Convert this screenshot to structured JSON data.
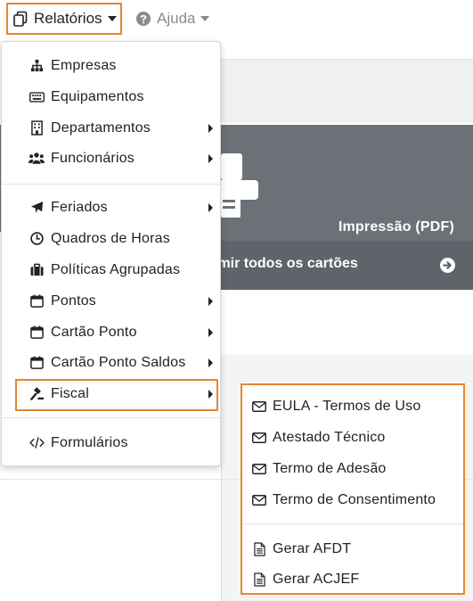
{
  "nav": {
    "relatorios_label": "Relatórios",
    "ajuda_label": "Ajuda",
    "relatorios_icon": "clipboard-copy-icon",
    "ajuda_icon": "question-circle-icon"
  },
  "background": {
    "card_title": "Impressão (PDF)",
    "card_action": "imir todos os cartões",
    "card_colors": {
      "card": "#6c7177",
      "card_lower": "#5f646a"
    }
  },
  "menu": {
    "items": [
      {
        "label": "Empresas",
        "icon": "sitemap-icon",
        "has_submenu": false
      },
      {
        "label": "Equipamentos",
        "icon": "keyboard-icon",
        "has_submenu": false
      },
      {
        "label": "Departamentos",
        "icon": "building-icon",
        "has_submenu": true
      },
      {
        "label": "Funcionários",
        "icon": "users-icon",
        "has_submenu": true
      },
      {
        "label": "Feriados",
        "icon": "plane-icon",
        "has_submenu": true
      },
      {
        "label": "Quadros de Horas",
        "icon": "clock-icon",
        "has_submenu": false
      },
      {
        "label": "Políticas Agrupadas",
        "icon": "briefcase-icon",
        "has_submenu": false
      },
      {
        "label": "Pontos",
        "icon": "calendar-icon",
        "has_submenu": true
      },
      {
        "label": "Cartão Ponto",
        "icon": "calendar-icon",
        "has_submenu": true
      },
      {
        "label": "Cartão Ponto Saldos",
        "icon": "calendar-icon",
        "has_submenu": true
      },
      {
        "label": "Fiscal",
        "icon": "gavel-icon",
        "has_submenu": true,
        "highlighted": true
      },
      {
        "label": "Formulários",
        "icon": "code-icon",
        "has_submenu": false
      }
    ]
  },
  "submenu": {
    "items": [
      {
        "label": "EULA - Termos de Uso",
        "icon": "envelope-icon"
      },
      {
        "label": "Atestado Técnico",
        "icon": "envelope-icon"
      },
      {
        "label": "Termo de Adesão",
        "icon": "envelope-icon"
      },
      {
        "label": "Termo de Consentimento",
        "icon": "envelope-icon"
      },
      {
        "label": "Gerar AFDT",
        "icon": "file-text-icon"
      },
      {
        "label": "Gerar ACJEF",
        "icon": "file-text-icon"
      }
    ]
  },
  "colors": {
    "highlight": "#e8862f",
    "text": "#222222",
    "muted": "#8a8a8a"
  }
}
